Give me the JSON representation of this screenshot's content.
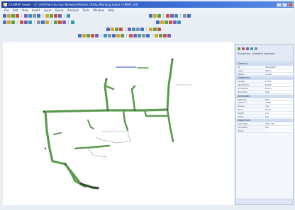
{
  "window": {
    "title": "CADMAP Sewer - [C:\\GIS\\Field Survey Network\\Master Utility Working Layer (CMAP_v4)]",
    "controls": [
      "minimize",
      "maximize",
      "close"
    ]
  },
  "menubar": {
    "items": [
      "File",
      "Edit",
      "View",
      "Insert",
      "Layer",
      "Query",
      "Analysis",
      "Tools",
      "Window",
      "Help"
    ]
  },
  "colors": {
    "network": "#5a9a4e",
    "network_dark": "#2f4f2a",
    "annotation": "#4a68c9",
    "title_bar": "#1f3f9e",
    "panel_header": "#cfdbee"
  },
  "toolbar_row1": {
    "icons": [
      "new-icon",
      "open-icon",
      "save-icon",
      "print-icon",
      "cut-icon",
      "copy-icon",
      "paste-icon",
      "undo-icon",
      "redo-icon",
      "zoom-in-icon",
      "zoom-out-icon",
      "pan-icon",
      "identify-icon"
    ]
  },
  "toolbar_row2": {
    "icons": [
      "select-icon",
      "draw-line-icon",
      "node-icon",
      "measure-icon",
      "snap-icon",
      "layer-icon",
      "refresh-icon",
      "filter-icon"
    ]
  },
  "toolbar_row3": {
    "icons": [
      "pipe-icon",
      "valve-icon",
      "manhole-icon",
      "pump-icon",
      "meter-icon",
      "label-icon"
    ]
  },
  "toolbar_row4": {
    "icons": [
      "grid-icon",
      "legend-icon",
      "export-icon",
      "report-icon",
      "settings-icon"
    ]
  },
  "panel": {
    "title": "Properties - Network Segment",
    "sections": [
      {
        "head": "General",
        "rows": [
          {
            "k": "ID",
            "v": "SEG-0412"
          },
          {
            "k": "Layer",
            "v": "Mains"
          },
          {
            "k": "Status",
            "v": "Active"
          }
        ]
      },
      {
        "head": "Geometry",
        "rows": [
          {
            "k": "Length",
            "v": "124.6"
          },
          {
            "k": "Start Node",
            "v": "N-210"
          },
          {
            "k": "End Node",
            "v": "N-211"
          },
          {
            "k": "Diameter",
            "v": "300"
          }
        ]
      },
      {
        "head": "Attributes",
        "rows": [
          {
            "k": "Material",
            "v": "PVC"
          },
          {
            "k": "Install Yr",
            "v": "1998"
          },
          {
            "k": "Owner",
            "v": "City"
          },
          {
            "k": "Zone",
            "v": "North"
          },
          {
            "k": "Depth",
            "v": "2.4"
          },
          {
            "k": "Slope",
            "v": "0.8"
          }
        ]
      },
      {
        "head": "Inspection",
        "rows": [
          {
            "k": "Last Date",
            "v": "2011-05"
          },
          {
            "k": "Condition",
            "v": "Fair"
          },
          {
            "k": "Notes",
            "v": "-"
          }
        ]
      }
    ]
  }
}
